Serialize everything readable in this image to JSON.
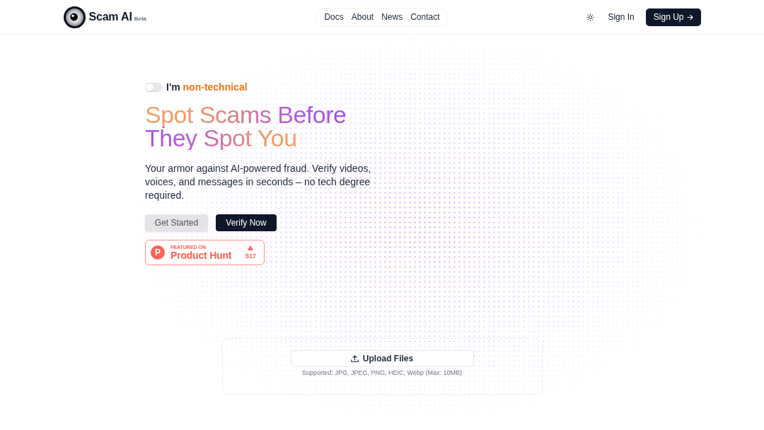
{
  "header": {
    "logo": {
      "name": "Scam AI",
      "badge": "Beta"
    },
    "nav": [
      {
        "label": "Docs"
      },
      {
        "label": "About"
      },
      {
        "label": "News"
      },
      {
        "label": "Contact"
      }
    ],
    "actions": {
      "sign_in": "Sign In",
      "sign_up": "Sign Up"
    }
  },
  "hero": {
    "mode_toggle": {
      "on": false,
      "text": "I'm",
      "highlight": "non-technical"
    },
    "headline": "Spot Scams Before They Spot You",
    "description": "Your armor against AI-powered fraud. Verify videos, voices, and messages in seconds – no tech degree required.",
    "buttons": [
      {
        "label": "Get Started",
        "kind": "secondary"
      },
      {
        "label": "Verify Now",
        "kind": "primary"
      }
    ],
    "product_hunt_badge": {
      "logo_letter": "P",
      "eyebrow": "FEATURED ON",
      "name": "Product Hunt",
      "upvotes": "517"
    }
  },
  "upload": {
    "button": "Upload Files",
    "hint": "Supported: JPG, JPEG, PNG, HEIC, Webp (Max: 10MB)"
  }
}
